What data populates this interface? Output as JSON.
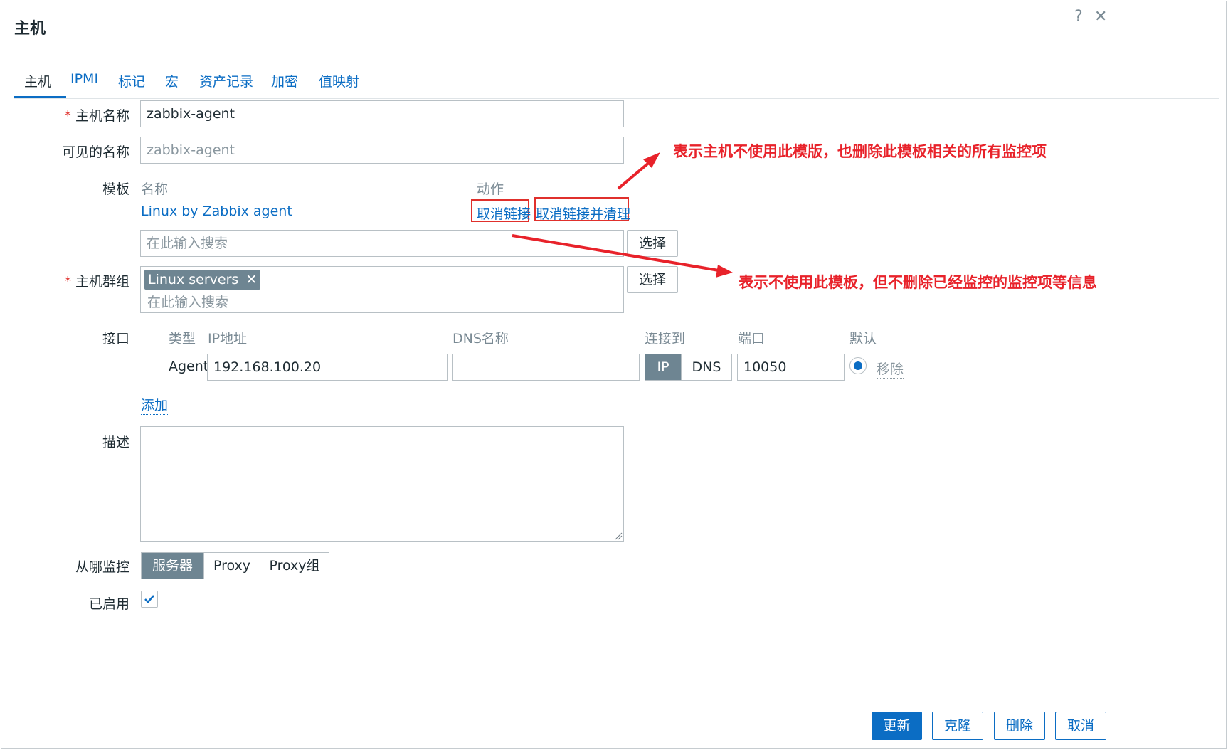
{
  "dialog": {
    "title": "主机",
    "help": "?",
    "close": "✕"
  },
  "tabs": [
    {
      "label": "主机"
    },
    {
      "label": "IPMI"
    },
    {
      "label": "标记"
    },
    {
      "label": "宏"
    },
    {
      "label": "资产记录"
    },
    {
      "label": "加密"
    },
    {
      "label": "值映射"
    }
  ],
  "form": {
    "host_name_label": "主机名称",
    "required_mark": "*",
    "host_name_value": "zabbix-agent",
    "visible_name_label": "可见的名称",
    "visible_name_placeholder": "zabbix-agent",
    "templates_label": "模板",
    "templates_col_name": "名称",
    "templates_col_action": "动作",
    "template_name": "Linux by Zabbix agent",
    "unlink": "取消链接",
    "unlink_clear": "取消链接并清理",
    "template_search_placeholder": "在此输入搜索",
    "select_button": "选择",
    "host_groups_label": "主机群组",
    "host_group_tag": "Linux servers",
    "host_group_tag_remove": "✕",
    "host_group_search_placeholder": "在此输入搜索",
    "interfaces_label": "接口",
    "iface_col_type": "类型",
    "iface_col_ip": "IP地址",
    "iface_col_dns": "DNS名称",
    "iface_col_connect": "连接到",
    "iface_col_port": "端口",
    "iface_col_default": "默认",
    "iface_type": "Agent",
    "iface_ip": "192.168.100.20",
    "iface_dns": "",
    "iface_connect_ip": "IP",
    "iface_connect_dns": "DNS",
    "iface_port": "10050",
    "iface_remove": "移除",
    "add_link": "添加",
    "description_label": "描述",
    "monitored_by_label": "从哪监控",
    "monitored_by_options": [
      "服务器",
      "Proxy",
      "Proxy组"
    ],
    "enabled_label": "已启用",
    "enabled": true
  },
  "annotations": {
    "unlink_clear_note": "表示主机不使用此模版，也删除此模板相关的所有监控项",
    "unlink_note": "表示不使用此模板，但不删除已经监控的监控项等信息",
    "color": "#e8222a"
  },
  "footer": {
    "update": "更新",
    "clone": "克隆",
    "delete": "删除",
    "cancel": "取消"
  },
  "colors": {
    "accent": "#0b6dc4",
    "segment_active": "#6e8592",
    "required": "#e0302c"
  }
}
